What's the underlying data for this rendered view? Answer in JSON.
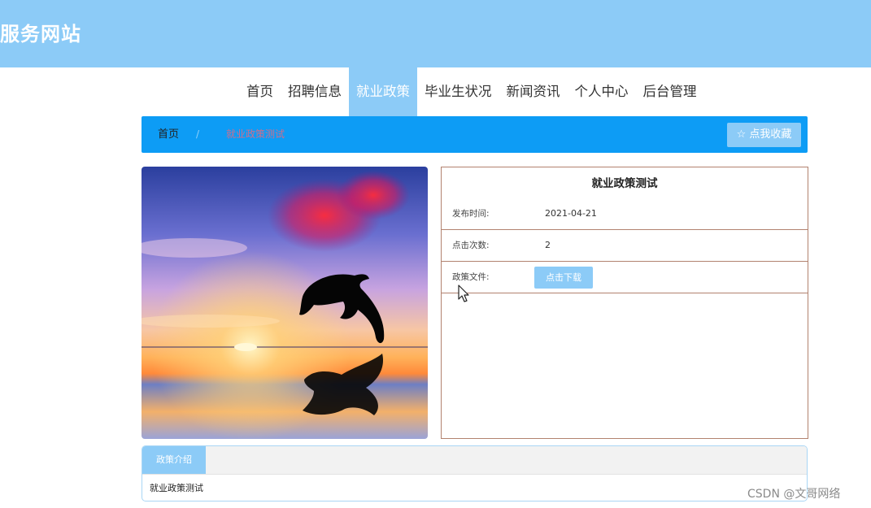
{
  "header": {
    "site_title": "服务网站"
  },
  "nav": {
    "items": [
      {
        "label": "首页"
      },
      {
        "label": "招聘信息"
      },
      {
        "label": "就业政策",
        "active": true
      },
      {
        "label": "毕业生状况"
      },
      {
        "label": "新闻资讯"
      },
      {
        "label": "个人中心"
      },
      {
        "label": "后台管理"
      }
    ]
  },
  "breadcrumb": {
    "home": "首页",
    "separator": "/",
    "current": "就业政策测试",
    "favorite_label": "☆ 点我收藏"
  },
  "detail": {
    "title": "就业政策测试",
    "rows": [
      {
        "label": "发布时间:",
        "value": "2021-04-21"
      },
      {
        "label": "点击次数:",
        "value": "2"
      },
      {
        "label": "政策文件:",
        "button": "点击下载"
      }
    ]
  },
  "intro": {
    "tab_label": "政策介绍",
    "content": "就业政策测试"
  },
  "watermark": "CSDN @文哥网络",
  "colors": {
    "header_bg": "#8ccbf7",
    "breadcrumb_bg": "#0d9cf5",
    "accent": "#8ccbf7",
    "detail_border": "#b2826f"
  }
}
